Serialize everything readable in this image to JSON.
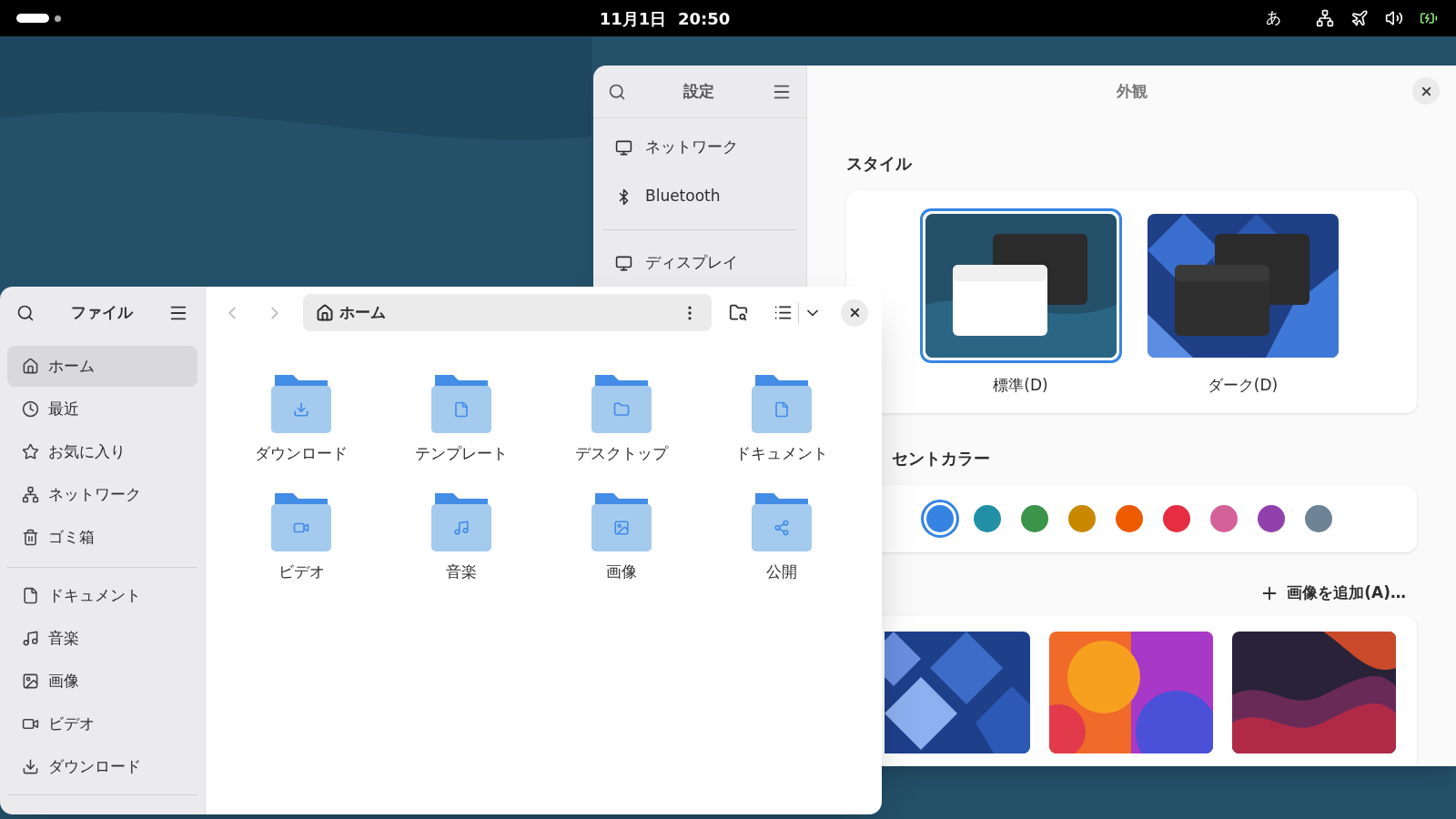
{
  "top_bar": {
    "clock": "11月1日  20:50",
    "input_method": "あ"
  },
  "settings": {
    "title": "設定",
    "pane_title": "外観",
    "sidebar": [
      {
        "label": "ネットワーク"
      },
      {
        "label": "Bluetooth"
      },
      {
        "label": "ディスプレイ"
      }
    ],
    "style": {
      "heading": "スタイル",
      "options": [
        {
          "label": "標準(D)",
          "selected": true
        },
        {
          "label": "ダーク(D)",
          "selected": false
        }
      ]
    },
    "accent": {
      "heading": "セントカラー",
      "colors": [
        {
          "color": "#3584e4",
          "selected": true
        },
        {
          "color": "#2190a4",
          "selected": false
        },
        {
          "color": "#3a944a",
          "selected": false
        },
        {
          "color": "#c88800",
          "selected": false
        },
        {
          "color": "#ed5b00",
          "selected": false
        },
        {
          "color": "#e62d42",
          "selected": false
        },
        {
          "color": "#d56199",
          "selected": false
        },
        {
          "color": "#9141ac",
          "selected": false
        },
        {
          "color": "#6f8396",
          "selected": false
        }
      ]
    },
    "background": {
      "add_button": "画像を追加(A)…"
    }
  },
  "files": {
    "title": "ファイル",
    "path": "ホーム",
    "places": [
      {
        "label": "ホーム",
        "selected": true
      },
      {
        "label": "最近",
        "selected": false
      },
      {
        "label": "お気に入り",
        "selected": false
      },
      {
        "label": "ネットワーク",
        "selected": false
      },
      {
        "label": "ゴミ箱",
        "selected": false
      }
    ],
    "bookmarks": [
      {
        "label": "ドキュメント",
        "selected": false
      },
      {
        "label": "音楽",
        "selected": false
      },
      {
        "label": "画像",
        "selected": false
      },
      {
        "label": "ビデオ",
        "selected": false
      },
      {
        "label": "ダウンロード",
        "selected": false
      }
    ],
    "folders": [
      {
        "label": "ダウンロード"
      },
      {
        "label": "テンプレート"
      },
      {
        "label": "デスクトップ"
      },
      {
        "label": "ドキュメント"
      },
      {
        "label": "ビデオ"
      },
      {
        "label": "音楽"
      },
      {
        "label": "画像"
      },
      {
        "label": "公開"
      }
    ]
  }
}
